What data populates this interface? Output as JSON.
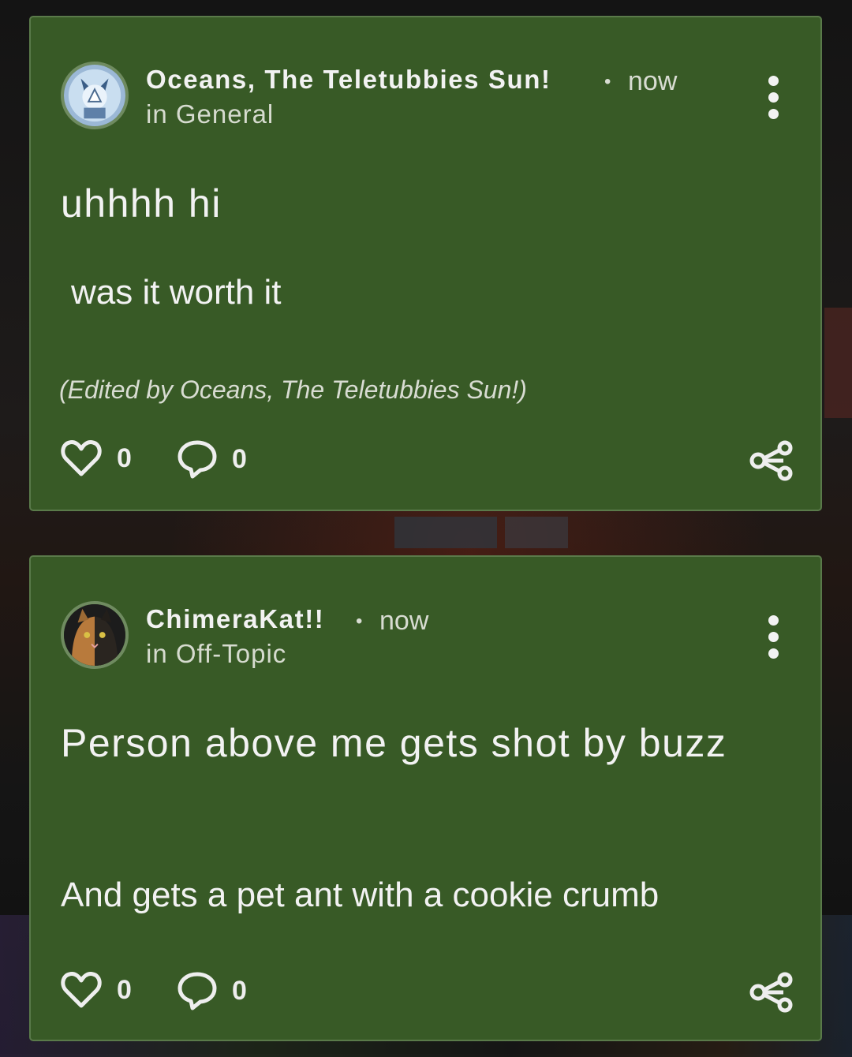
{
  "posts": [
    {
      "author": "Oceans, The Teletubbies Sun!",
      "separator": "•",
      "time": "now",
      "category": "in General",
      "title": "uhhhh hi",
      "body": "was it worth it",
      "edited_note": "(Edited by Oceans, The Teletubbies Sun!)",
      "likes": "0",
      "comments": "0"
    },
    {
      "author": "ChimeraKat!!",
      "separator": "•",
      "time": "now",
      "category": "in Off-Topic",
      "title": "Person above me gets shot by buzz",
      "body": "And gets a pet ant with a cookie crumb",
      "likes": "0",
      "comments": "0"
    }
  ],
  "colors": {
    "card_background": "#385a26",
    "card_border": "#5a7a4a",
    "text_primary": "#f2f2f2",
    "text_secondary": "#d8dcd2"
  },
  "icons": {
    "like": "heart-icon",
    "comment": "comment-bubble-icon",
    "share": "share-icon",
    "menu": "more-vertical-icon"
  }
}
